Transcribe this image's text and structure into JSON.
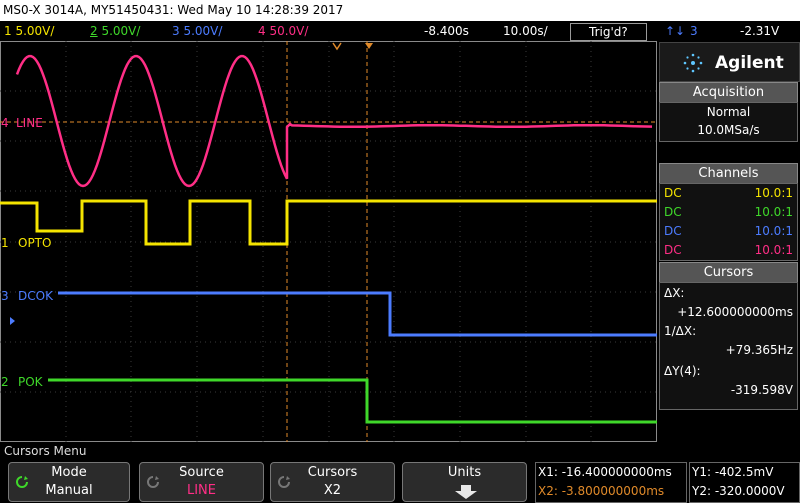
{
  "title": "MS0-X 3014A, MY51450431: Wed May 10 14:28:39 2017",
  "status": {
    "ch1": {
      "num": "1",
      "scale": "5.00V/"
    },
    "ch2": {
      "num": "2",
      "scale": "5.00V/"
    },
    "ch3": {
      "num": "3",
      "scale": "5.00V/"
    },
    "ch4": {
      "num": "4",
      "scale": "50.0V/"
    },
    "delay": "-8.400s",
    "timebase": "10.00s/",
    "trig_state": "Trig'd?",
    "trig_source_num": "3",
    "trig_level": "-2.31V"
  },
  "waveform_labels": {
    "line": "LINE",
    "line_num": "4",
    "opto": "OPTO",
    "opto_num": "1",
    "dcok": "DCOK",
    "dcok_num": "3",
    "pok": "POK",
    "pok_num": "2"
  },
  "panel": {
    "brand": "Agilent",
    "acquisition": {
      "header": "Acquisition",
      "mode": "Normal",
      "rate": "10.0MSa/s"
    },
    "channels": {
      "header": "Channels",
      "rows": [
        {
          "coupling": "DC",
          "probe": "10.0:1"
        },
        {
          "coupling": "DC",
          "probe": "10.0:1"
        },
        {
          "coupling": "DC",
          "probe": "10.0:1"
        },
        {
          "coupling": "DC",
          "probe": "10.0:1"
        }
      ]
    },
    "cursors": {
      "header": "Cursors",
      "dx_label": "ΔX:",
      "dx_value": "+12.600000000ms",
      "inv_dx_label": "1/ΔX:",
      "inv_dx_value": "+79.365Hz",
      "dy_label": "ΔY(4):",
      "dy_value": "-319.598V"
    }
  },
  "menu": {
    "title": "Cursors Menu",
    "keys": [
      {
        "top": "Mode",
        "bottom": "Manual"
      },
      {
        "top": "Source",
        "bottom": "LINE"
      },
      {
        "top": "Cursors",
        "bottom": "X2"
      },
      {
        "top": "Units",
        "bottom": ""
      }
    ]
  },
  "cursor_readout": {
    "x1": "X1: -16.400000000ms",
    "x2": "X2: -3.800000000ms",
    "y1": "Y1: -402.5mV",
    "y2": "Y2: -320.0000V"
  },
  "colors": {
    "ch1": "#f5e400",
    "ch2": "#3fd82a",
    "ch3": "#4c7cff",
    "ch4": "#ff2e86"
  }
}
